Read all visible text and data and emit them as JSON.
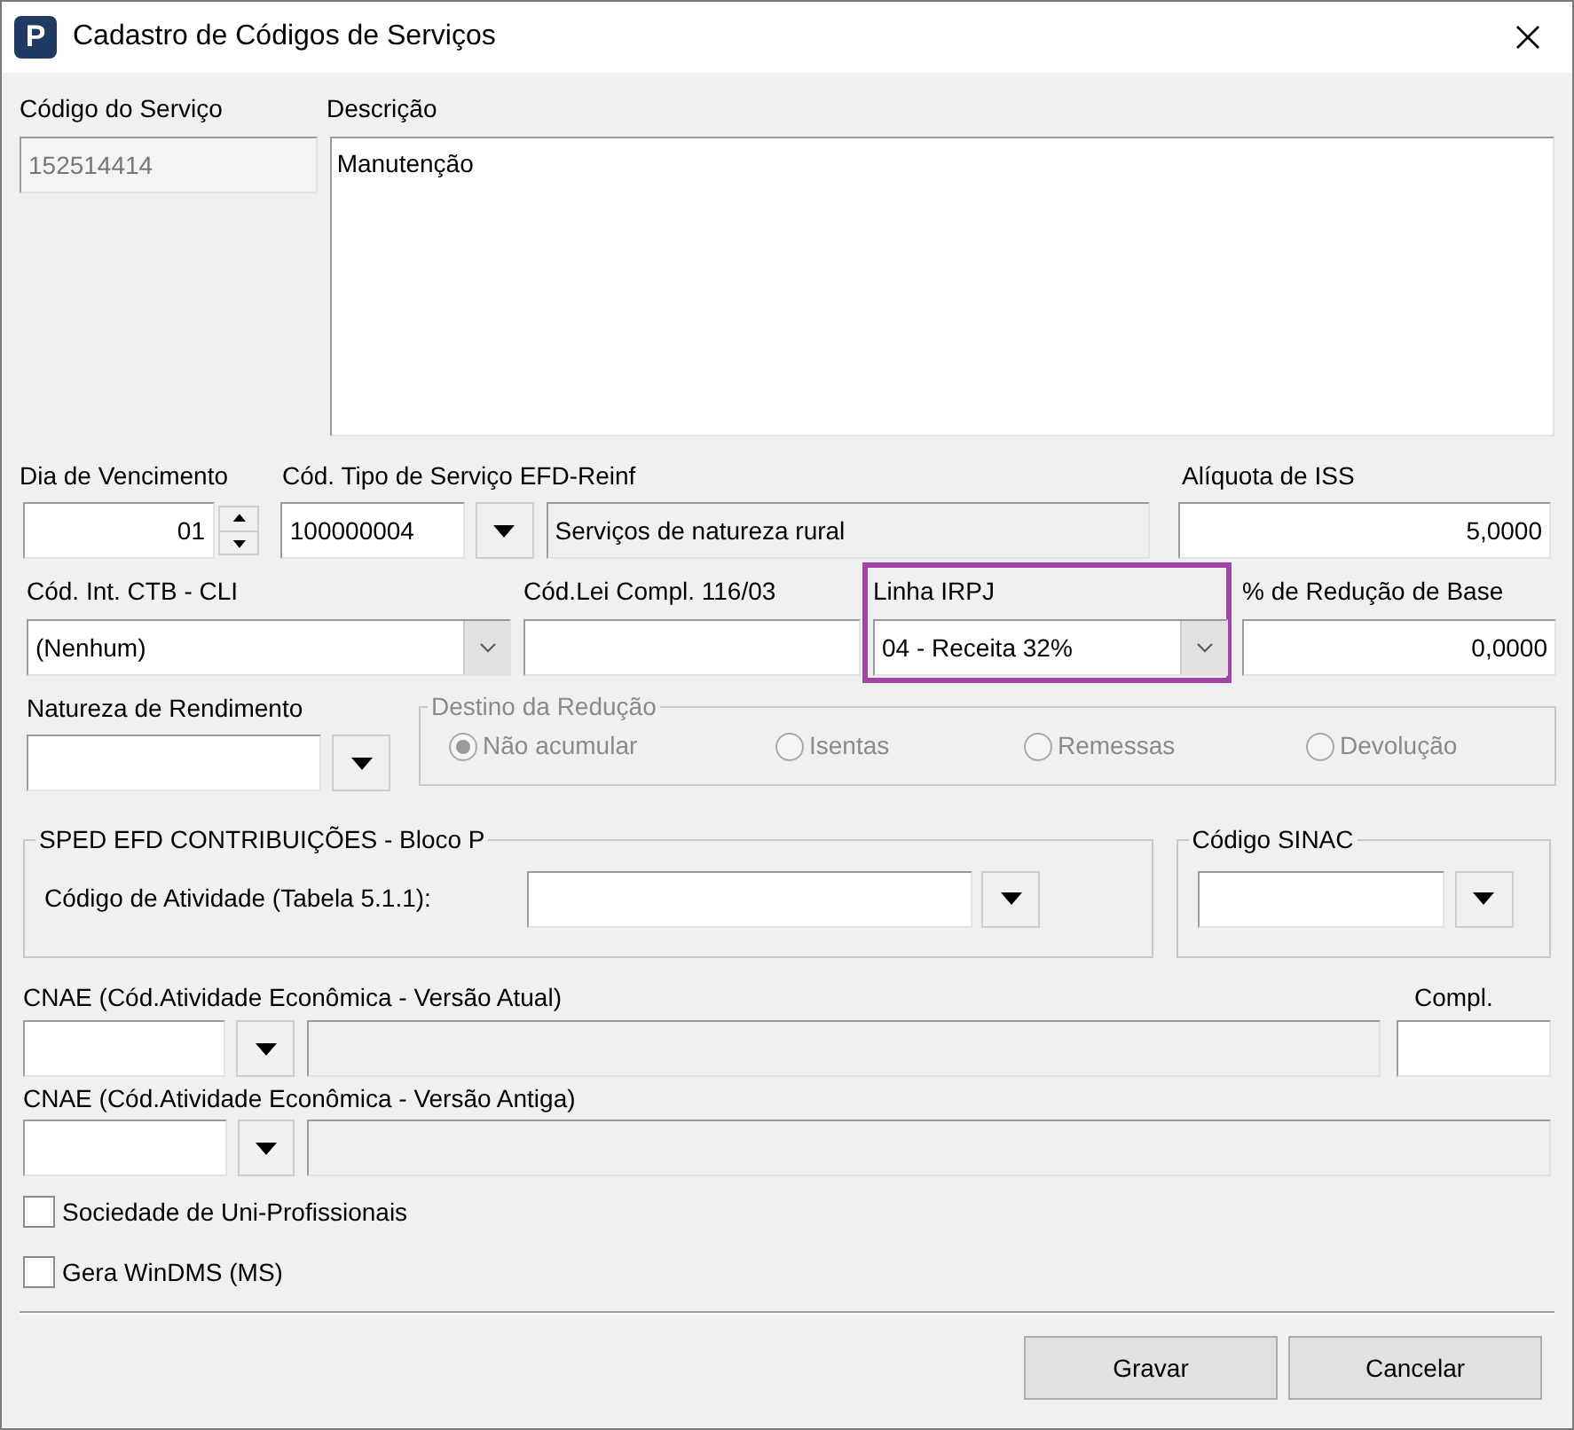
{
  "window": {
    "logo_text": "P",
    "title": "Cadastro de Códigos de Serviços"
  },
  "codigo_servico": {
    "label": "Código do Serviço",
    "value": "152514414",
    "disabled": true
  },
  "descricao": {
    "label": "Descrição",
    "value": "Manutenção"
  },
  "dia_vencimento": {
    "label": "Dia de Vencimento",
    "value": "01"
  },
  "tipo_servico_reinf": {
    "label": "Cód. Tipo de Serviço EFD-Reinf",
    "code": "100000004",
    "description": "Serviços de natureza rural"
  },
  "aliquota_iss": {
    "label": "Alíquota de ISS",
    "value": "5,0000"
  },
  "cod_int_ctb": {
    "label": "Cód. Int. CTB - CLI",
    "value": "(Nenhum)"
  },
  "cod_lei_compl": {
    "label": "Cód.Lei Compl. 116/03"
  },
  "linha_irpj": {
    "label": "Linha IRPJ",
    "value": "04 - Receita 32%",
    "highlighted": true
  },
  "reducao_base": {
    "label": "% de Redução de Base",
    "value": "0,0000"
  },
  "natureza_rendimento": {
    "label": "Natureza de Rendimento"
  },
  "destino_reducao": {
    "title": "Destino da Redução",
    "disabled": true,
    "options": [
      {
        "label": "Não acumular",
        "selected": true
      },
      {
        "label": "Isentas",
        "selected": false
      },
      {
        "label": "Remessas",
        "selected": false
      },
      {
        "label": "Devolução",
        "selected": false
      }
    ]
  },
  "sped": {
    "title": "SPED EFD CONTRIBUIÇÕES - Bloco P",
    "field_label": "Código de Atividade (Tabela 5.1.1):"
  },
  "codigo_sinac": {
    "title": "Código SINAC"
  },
  "cnae_atual": {
    "label": "CNAE (Cód.Atividade Econômica - Versão Atual)"
  },
  "compl": {
    "label": "Compl."
  },
  "cnae_antiga": {
    "label": "CNAE (Cód.Atividade Econômica - Versão Antiga)"
  },
  "checkboxes": [
    {
      "label": "Sociedade de Uni-Profissionais",
      "checked": false
    },
    {
      "label": "Gera WinDMS (MS)",
      "checked": false
    }
  ],
  "buttons": [
    {
      "label": "Gravar"
    },
    {
      "label": "Cancelar"
    }
  ]
}
